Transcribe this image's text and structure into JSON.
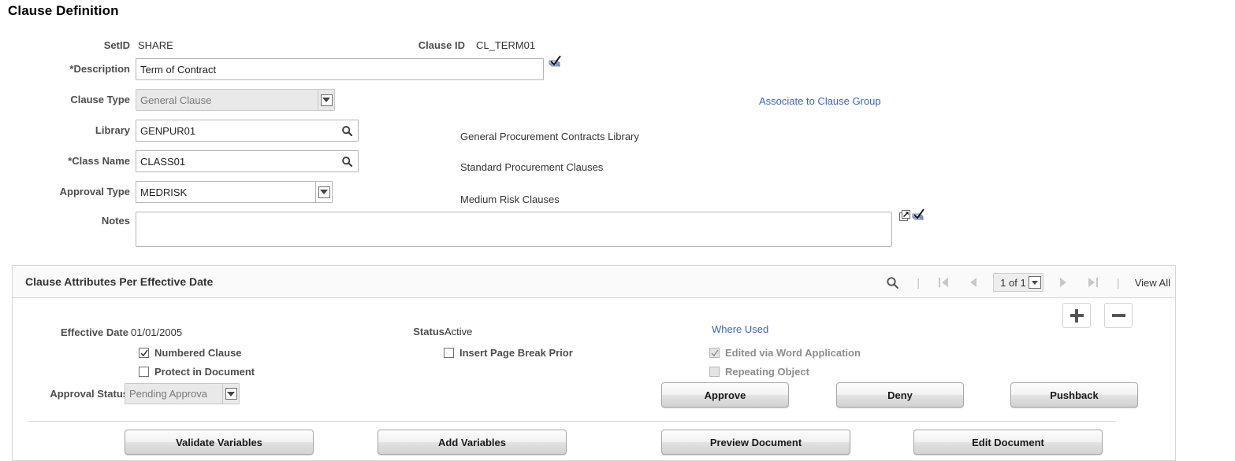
{
  "page": {
    "title": "Clause Definition"
  },
  "header": {
    "setid_label": "SetID",
    "setid_value": "SHARE",
    "clause_id_label": "Clause ID",
    "clause_id_value": "CL_TERM01"
  },
  "form": {
    "description_label": "*Description",
    "description_value": "Term of Contract",
    "description_spellcheck_icon": "spellcheck-icon",
    "clause_type_label": "Clause Type",
    "clause_type_value": "General Clause",
    "clause_type_disabled": true,
    "associate_link": "Associate to Clause Group",
    "library_label": "Library",
    "library_value": "GENPUR01",
    "library_desc": "General Procurement Contracts Library",
    "library_lookup_icon": "search-icon",
    "class_name_label": "*Class Name",
    "class_name_value": "CLASS01",
    "class_name_desc": "Standard Procurement Clauses",
    "class_name_lookup_icon": "search-icon",
    "approval_type_label": "Approval Type",
    "approval_type_value": "MEDRISK",
    "approval_type_desc": "Medium Risk Clauses",
    "notes_label": "Notes",
    "notes_value": "",
    "notes_placeholder": "",
    "notes_expand_icon": "expand-icon",
    "notes_spellcheck_icon": "spellcheck-icon"
  },
  "attributes_panel": {
    "title": "Clause Attributes Per Effective Date",
    "pager": {
      "search_icon": "search-icon",
      "separator": "|",
      "first_icon": "first-page-icon",
      "prev_icon": "previous-page-icon",
      "counter": "1 of 1",
      "counter_chevron_icon": "chevron-down-icon",
      "next_icon": "next-page-icon",
      "last_icon": "last-page-icon",
      "view_all": "View All"
    },
    "effective_date_label": "Effective Date",
    "effective_date_value": "01/01/2005",
    "status_label": "Status",
    "status_value": "Active",
    "where_used_link": "Where Used",
    "add_row_icon": "plus-icon",
    "delete_row_icon": "minus-icon",
    "checkboxes": [
      {
        "name": "numbered-clause",
        "label": "Numbered Clause",
        "checked": true,
        "disabled": false
      },
      {
        "name": "protect-in-document",
        "label": "Protect in Document",
        "checked": false,
        "disabled": false
      },
      {
        "name": "insert-page-break-prior",
        "label": "Insert Page Break Prior",
        "checked": false,
        "disabled": false
      },
      {
        "name": "edited-via-word-application",
        "label": "Edited via Word Application",
        "checked": true,
        "disabled": true
      },
      {
        "name": "repeating-object",
        "label": "Repeating Object",
        "checked": false,
        "disabled": true
      }
    ],
    "approval_status_label": "Approval Status",
    "approval_status_value": "Pending Approva",
    "approval_status_disabled": true,
    "approve_button": "Approve",
    "deny_button": "Deny",
    "pushback_button": "Pushback",
    "validate_variables_button": "Validate Variables",
    "add_variables_button": "Add Variables",
    "preview_document_button": "Preview Document",
    "edit_document_button": "Edit Document"
  },
  "colors": {
    "link": "#3a64c8",
    "label": "#4d4d4d",
    "panel_border": "#d6d6d6",
    "panel_header_bg": "#fafafa",
    "disabled_bg": "#e9e9e9"
  }
}
